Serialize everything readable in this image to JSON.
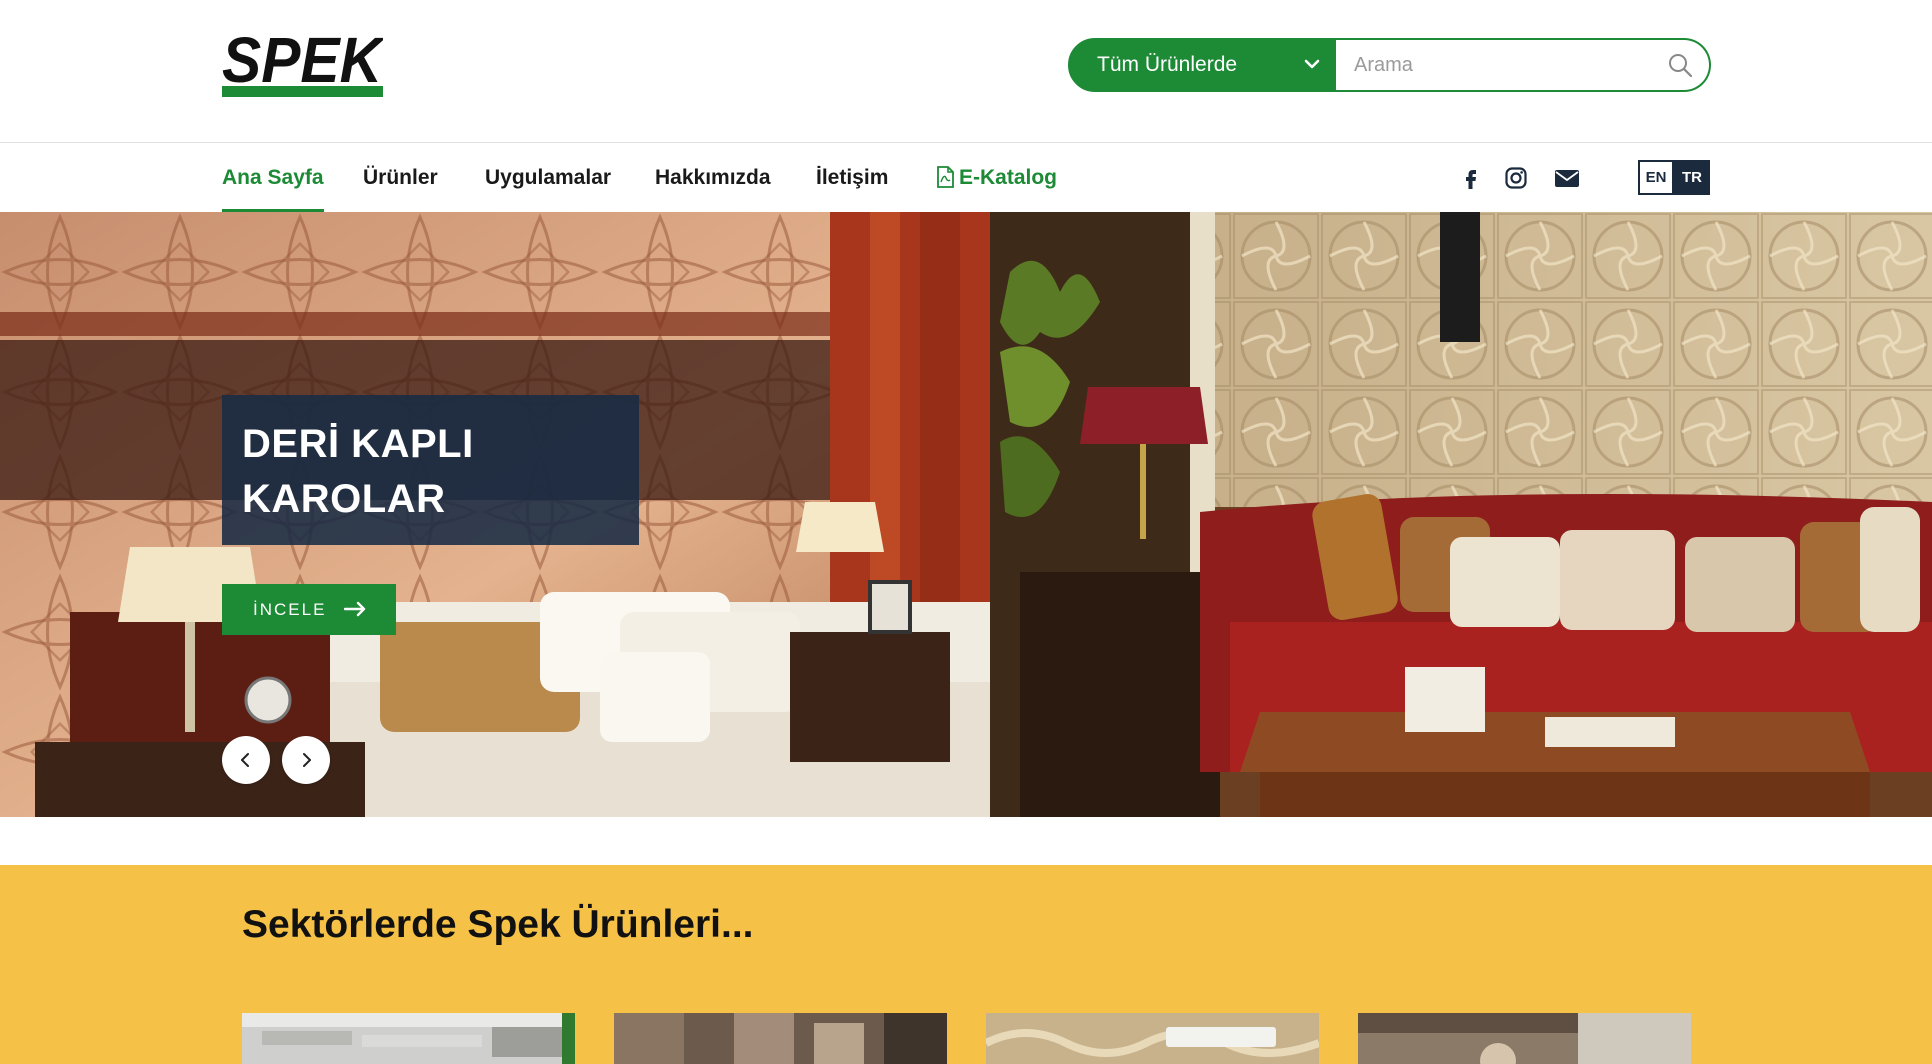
{
  "brand": {
    "logo_text": "SPEK",
    "green": "#1d8a36",
    "navy": "#1b2b3d",
    "yellow": "#f5c146"
  },
  "search": {
    "category_selected": "Tüm Ürünlerde",
    "placeholder": "Arama",
    "value": "",
    "category_icon": "chevron-down-icon",
    "button_icon": "search-icon"
  },
  "nav": {
    "items": [
      {
        "label": "Ana Sayfa",
        "active": true
      },
      {
        "label": "Ürünler"
      },
      {
        "label": "Uygulamalar"
      },
      {
        "label": "Hakkımızda"
      },
      {
        "label": "İletişim"
      },
      {
        "label": "E-Katalog",
        "icon": "pdf-file-icon"
      }
    ],
    "social": [
      "facebook-icon",
      "instagram-icon",
      "envelope-icon"
    ],
    "languages": [
      {
        "code": "EN",
        "active": false
      },
      {
        "code": "TR",
        "active": true
      }
    ]
  },
  "hero": {
    "title_line1": "DERİ KAPLI",
    "title_line2": "KAROLAR",
    "button_label": "İNCELE",
    "button_icon": "arrow-right-icon",
    "prev_icon": "chevron-left-icon",
    "next_icon": "chevron-right-icon"
  },
  "sectors": {
    "heading": "Sektörlerde Spek Ürünleri..."
  }
}
